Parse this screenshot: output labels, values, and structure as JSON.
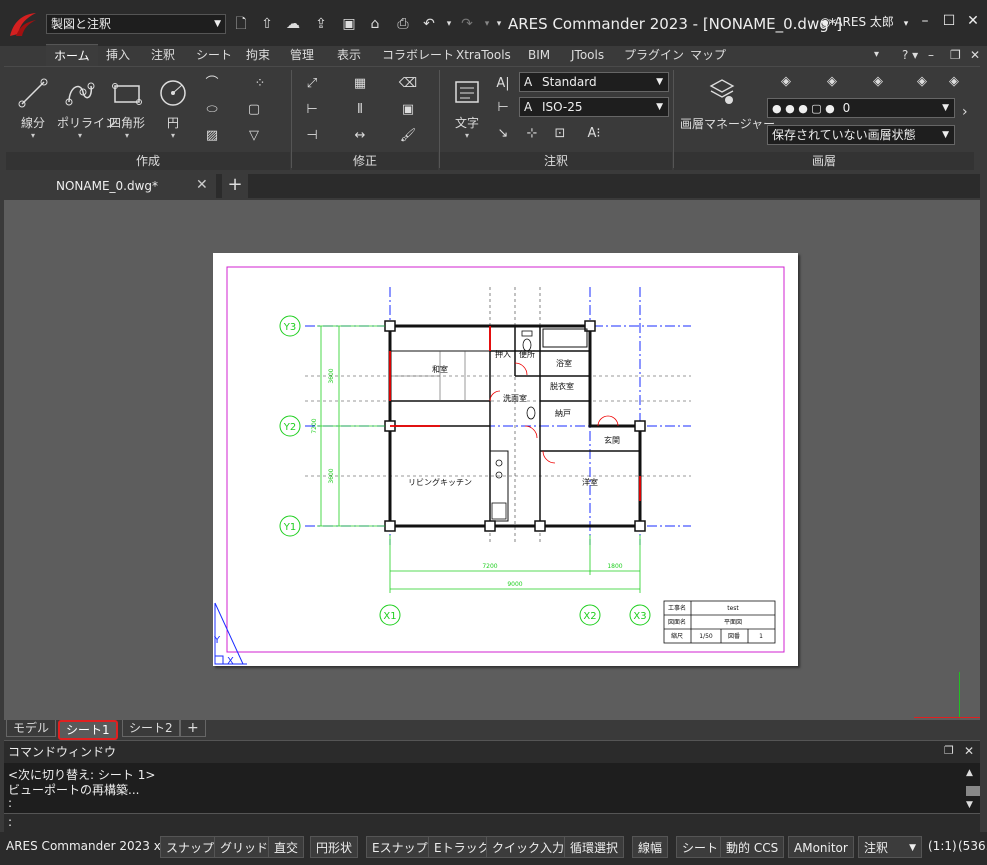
{
  "titlebar": {
    "workspace": "製図と注釈",
    "app_title": "ARES Commander 2023 - [NONAME_0.dwg*]",
    "user": "ARES 太郎"
  },
  "ribbon_tabs": [
    "ホーム",
    "挿入",
    "注釈",
    "シート",
    "拘束",
    "管理",
    "表示",
    "コラボレート",
    "XtraTools",
    "BIM",
    "JTools",
    "プラグイン",
    "マップ"
  ],
  "ribbon": {
    "create": {
      "title": "作成",
      "line": "線分",
      "polyline": "ポリライン",
      "rectangle": "四角形",
      "circle": "円"
    },
    "modify": {
      "title": "修正"
    },
    "annotation": {
      "title": "注釈",
      "text": "文字",
      "text_style": "Standard",
      "dim_style": "ISO-25"
    },
    "layer": {
      "title": "画層",
      "manager": "画層マネージャー",
      "current_layer": "0",
      "layer_state": "保存されていない画層状態"
    }
  },
  "document_tab": "NONAME_0.dwg*",
  "drawing": {
    "rooms": [
      "和室",
      "押入",
      "便所",
      "浴室",
      "脱衣室",
      "洗面室",
      "納戸",
      "玄関",
      "リビングキッチン",
      "洋室"
    ],
    "grid_y": [
      "Y3",
      "Y2",
      "Y1"
    ],
    "grid_x": [
      "X1",
      "X2",
      "X3"
    ],
    "dims_left": [
      "3600",
      "7200",
      "3600"
    ],
    "dims_bottom": [
      "7200",
      "1800",
      "9000"
    ],
    "title_block": {
      "r1_label": "工事名",
      "r1_value": "test",
      "r2_label": "図面名",
      "r2_value": "平面図",
      "r3_label1": "縮尺",
      "r3_value1": "1/50",
      "r3_label2": "図番",
      "r3_value2": "1"
    }
  },
  "sheet_tabs": [
    "モデル",
    "シート1",
    "シート2"
  ],
  "command_window": {
    "title": "コマンドウィンドウ",
    "lines": [
      "<次に切り替え: シート 1>",
      "ビューポートの再構築...",
      ":"
    ],
    "prompt": ":"
  },
  "statusbar": {
    "app": "ARES Commander 2023 x64",
    "buttons": [
      "スナップ",
      "グリッド",
      "直交",
      "円形状",
      "Eスナップ",
      "Eトラック",
      "クイック入力",
      "循環選択",
      "線幅",
      "シート",
      "動的 CCS",
      "AMonitor"
    ],
    "annotation": "注釈",
    "scale": "(1:1)",
    "coords": "(536."
  },
  "colors": {
    "accent_red": "#e02020",
    "grid_blue": "#1a2cff",
    "dim_green": "#1fcf1f",
    "border_magenta": "#d020d0"
  }
}
